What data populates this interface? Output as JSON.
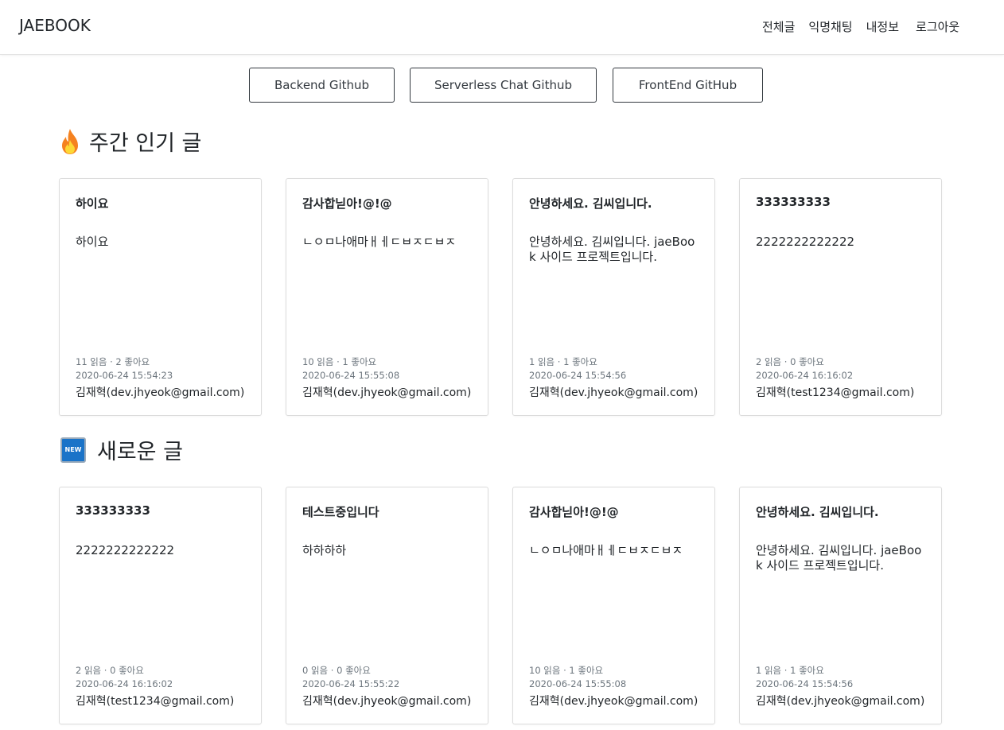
{
  "navbar": {
    "brand": "JAEBOOK",
    "links": [
      "전체글",
      "익명채팅",
      "내정보",
      "로그아웃"
    ]
  },
  "github_buttons": [
    "Backend Github",
    "Serverless Chat Github",
    "FrontEnd GitHub"
  ],
  "sections": {
    "popular": {
      "title": "주간 인기 글",
      "icon": "fire-icon",
      "cards": [
        {
          "title": "하이요",
          "body": "하이요",
          "stats": "11 읽음 · 2 좋아요",
          "date": "2020-06-24 15:54:23",
          "author": "김재혁(dev.jhyeok@gmail.com)"
        },
        {
          "title": "감사합닏아!@!@",
          "body": "ㄴㅇㅁ나애마ㅐㅔㄷㅂㅈㄷㅂㅈ",
          "stats": "10 읽음 · 1 좋아요",
          "date": "2020-06-24 15:55:08",
          "author": "김재혁(dev.jhyeok@gmail.com)"
        },
        {
          "title": "안녕하세요. 김씨입니다.",
          "body": "안녕하세요. 김씨입니다. jaeBook 사이드 프로젝트입니다.",
          "stats": "1 읽음 · 1 좋아요",
          "date": "2020-06-24 15:54:56",
          "author": "김재혁(dev.jhyeok@gmail.com)"
        },
        {
          "title": "333333333",
          "body": "2222222222222",
          "stats": "2 읽음 · 0 좋아요",
          "date": "2020-06-24 16:16:02",
          "author": "김재혁(test1234@gmail.com)"
        }
      ]
    },
    "newest": {
      "title": "새로운 글",
      "icon": "new-icon",
      "icon_text": "NEW",
      "cards": [
        {
          "title": "333333333",
          "body": "2222222222222",
          "stats": "2 읽음 · 0 좋아요",
          "date": "2020-06-24 16:16:02",
          "author": "김재혁(test1234@gmail.com)"
        },
        {
          "title": "테스트중입니다",
          "body": "하하하하",
          "stats": "0 읽음 · 0 좋아요",
          "date": "2020-06-24 15:55:22",
          "author": "김재혁(dev.jhyeok@gmail.com)"
        },
        {
          "title": "감사합닏아!@!@",
          "body": "ㄴㅇㅁ나애마ㅐㅔㄷㅂㅈㄷㅂㅈ",
          "stats": "10 읽음 · 1 좋아요",
          "date": "2020-06-24 15:55:08",
          "author": "김재혁(dev.jhyeok@gmail.com)"
        },
        {
          "title": "안녕하세요. 김씨입니다.",
          "body": "안녕하세요. 김씨입니다. jaeBook 사이드 프로젝트입니다.",
          "stats": "1 읽음 · 1 좋아요",
          "date": "2020-06-24 15:54:56",
          "author": "김재혁(dev.jhyeok@gmail.com)"
        }
      ]
    }
  },
  "colors": {
    "accent": "#212529",
    "muted": "#6c757d",
    "border": "#dcdcdc",
    "new_badge": "#1a73c8",
    "fire": "#f58220"
  }
}
